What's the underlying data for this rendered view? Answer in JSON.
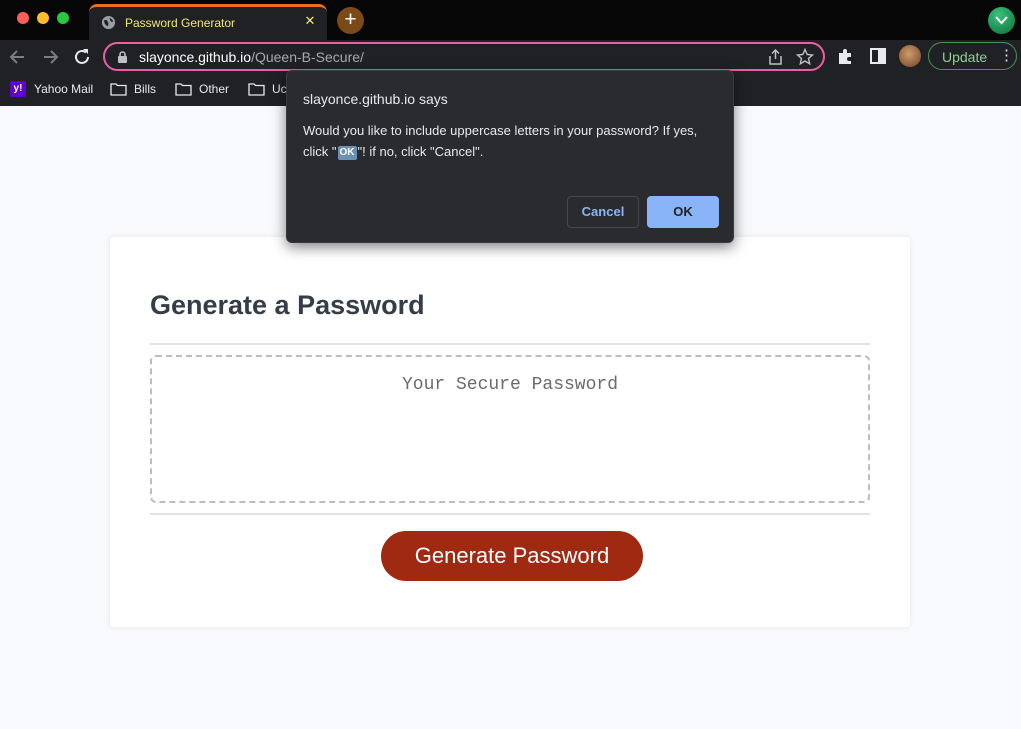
{
  "browser": {
    "tab": {
      "title": "Password Generator",
      "close": "✕"
    },
    "new_tab": "+",
    "url": {
      "host": "slayonce.github.io",
      "path": "/Queen-B-Secure/"
    },
    "update_label": "Update",
    "menu_glyph": "⋮",
    "bookmarks": [
      {
        "label": "Yahoo Mail",
        "icon": "yahoo-icon"
      },
      {
        "label": "Bills",
        "icon": "folder-icon"
      },
      {
        "label": "Other",
        "icon": "folder-icon"
      },
      {
        "label": "Uc",
        "icon": "folder-icon"
      }
    ],
    "colors": {
      "omnibox_border": "#ea5fa7",
      "tab_accent": "#e8711f",
      "tab_text": "#f3e86e",
      "update": "#8fd197"
    }
  },
  "page": {
    "title": "Generate a Password",
    "password_placeholder": "Your Secure Password",
    "generate_label": "Generate Password",
    "colors": {
      "button": "#a02912",
      "heading": "#353d47"
    }
  },
  "dialog": {
    "title": "slayonce.github.io says",
    "message_before": "Would you like to include uppercase letters in your password? If yes, click \"",
    "message_ok": "OK",
    "message_after": "\"! if no, click \"Cancel\".",
    "cancel_label": "Cancel",
    "ok_label": "OK"
  }
}
